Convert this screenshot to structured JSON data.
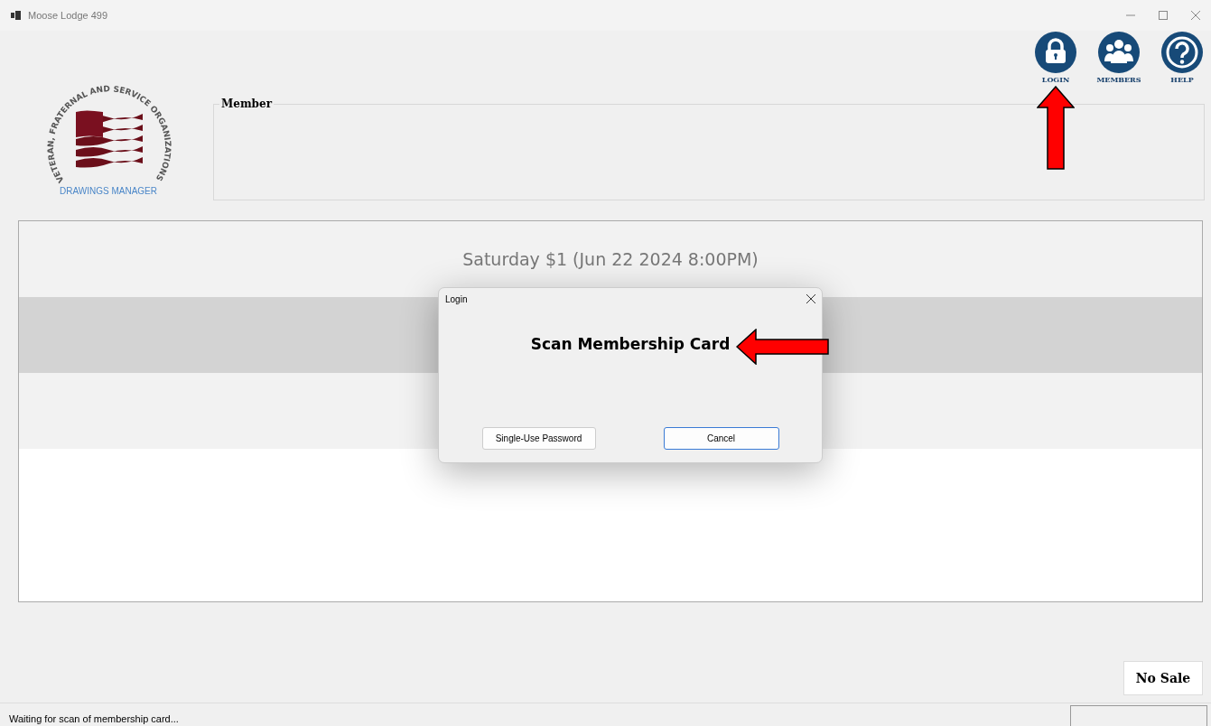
{
  "window": {
    "title": "Moose Lodge 499"
  },
  "toolbar": [
    {
      "kind": "lock",
      "label": "LOGIN"
    },
    {
      "kind": "people",
      "label": "MEMBERS"
    },
    {
      "kind": "help",
      "label": "HELP"
    }
  ],
  "logo": {
    "arc_text": "VETERAN, FRATERNAL AND SERVICE ORGANIZATIONS",
    "caption": "DRAWINGS MANAGER"
  },
  "member_group": {
    "title": "Member"
  },
  "drawings": [
    {
      "label": "Saturday $1 (Jun 22 2024  8:00PM)",
      "selected": false
    },
    {
      "selected": true
    },
    {
      "selected": false
    }
  ],
  "dialog": {
    "title": "Login",
    "message": "Scan Membership Card",
    "buttons": [
      {
        "label": "Single-Use Password",
        "selected": false
      },
      {
        "label": "Cancel",
        "selected": true
      }
    ]
  },
  "no_sale": {
    "label": "No Sale"
  },
  "status_bar": {
    "text": "Waiting for scan of membership card..."
  }
}
